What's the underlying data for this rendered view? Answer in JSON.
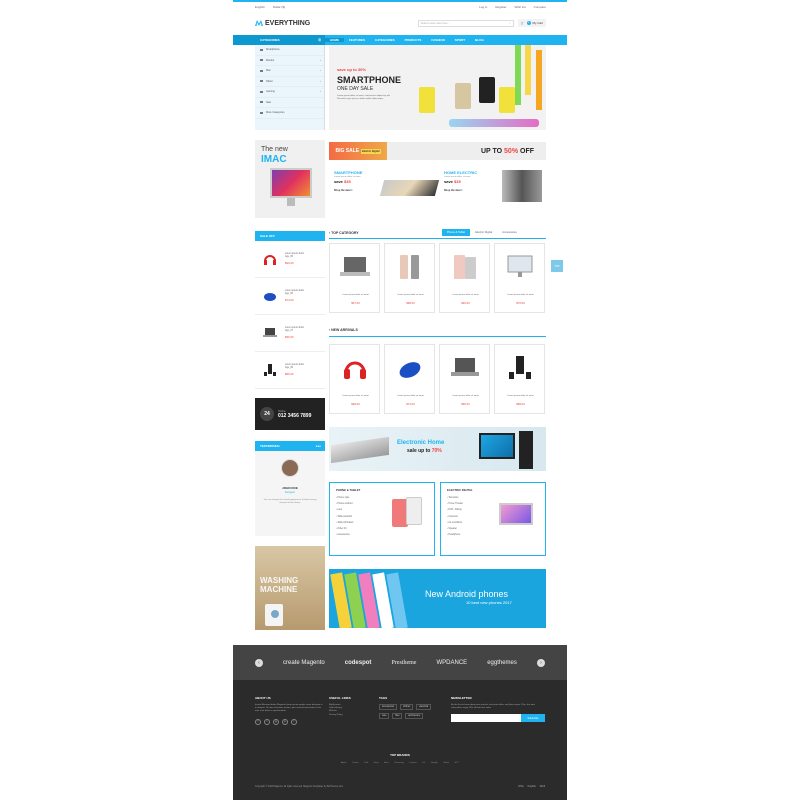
{
  "topbar": {
    "language": "English",
    "currency": "Dollar ($)",
    "links": [
      "Log in",
      "Register",
      "Wish list",
      "Compare"
    ]
  },
  "header": {
    "logo": "EVERYTHING",
    "search_placeholder": "Search entire store here...",
    "cart_count": "0",
    "cart_label": "My Cart"
  },
  "nav": {
    "categories_label": "CATEGORIES",
    "items": [
      "HOME",
      "FEATURES",
      "CATEGORIES",
      "PRODUCTS",
      "FASHION",
      "SPORT",
      "BLOG"
    ]
  },
  "sidebar_categories": [
    "Smartphone",
    "Monitor",
    "Mac",
    "Tablet",
    "Gaming",
    "Sale",
    "More Categories"
  ],
  "hero": {
    "subtitle": "save up to 30%",
    "title": "SMARTPHONE",
    "title2": "ONE DAY SALE",
    "description": "Lorem ipsum dolor sit amet, consectetur adipiscing elit. Phasellus quis ipsum a dolor mollis ullamcorper."
  },
  "imac_banner": {
    "line1": "The new",
    "line2": "IMAC"
  },
  "big_sale": {
    "label": "BIG SALE",
    "tag": "Electric Digital",
    "offer_prefix": "UP TO",
    "offer_value": "50%",
    "offer_suffix": "OFF"
  },
  "promos": [
    {
      "title": "SMARTPHONE",
      "desc": "Lorem ipsum dolor sit amet",
      "save_prefix": "save",
      "save_value": "$35",
      "cta": "Shop the deal >"
    },
    {
      "title": "HOME ELECTRIC",
      "desc": "Lorem ipsum dolor sit amet",
      "save_prefix": "save",
      "save_value": "$35",
      "cta": "Shop the deal >"
    }
  ],
  "sale_off": {
    "title": "SALE OFF",
    "items": [
      {
        "name": "Lorem ipsum dolor",
        "sub": "Agu_05",
        "price": "$99.00"
      },
      {
        "name": "Lorem ipsum dolor",
        "sub": "Agu_05",
        "price": "$74.00"
      },
      {
        "name": "Lorem ipsum dolor",
        "sub": "Agu_07",
        "price": "$56.00"
      },
      {
        "name": "Lorem ipsum dolor",
        "sub": "Agu_09",
        "price": "$89.00"
      }
    ]
  },
  "contact": {
    "phone": "012 3456 7899",
    "label": "Hotline"
  },
  "testimonial": {
    "title": "TESTIMONIAL",
    "name": "JOHN DOE",
    "role": "Designer",
    "quote": "You can change the visual appearance of almost every element of this theme"
  },
  "washer": {
    "line1": "WASHING",
    "line2": "MACHINE"
  },
  "top_category": {
    "title": "TOP CATEGORY",
    "tabs": [
      "Phone & Tablet",
      "Electric Digital",
      "Accessories"
    ],
    "products": [
      {
        "name": "Lorem ipsum dolor sit amet",
        "price": "$57.00"
      },
      {
        "name": "Lorem ipsum dolor sit amet",
        "price": "$98.00"
      },
      {
        "name": "Lorem ipsum dolor sit amet",
        "price": "$46.00"
      },
      {
        "name": "Lorem ipsum dolor sit amet",
        "price": "$76.00"
      }
    ]
  },
  "new_arrivals": {
    "title": "NEW ARRIVALS",
    "products": [
      {
        "name": "Lorem ipsum dolor sit amet",
        "price": "$99.00"
      },
      {
        "name": "Lorem ipsum dolor sit amet",
        "price": "$74.00"
      },
      {
        "name": "Lorem ipsum dolor sit amet",
        "price": "$56.00"
      },
      {
        "name": "Lorem ipsum dolor sit amet",
        "price": "$89.00"
      }
    ]
  },
  "top_badge": "TOP",
  "electronic_banner": {
    "line1": "Electronic Home",
    "line2_prefix": "sale up to",
    "line2_value": "70%"
  },
  "phone_tablet": {
    "title": "PHONE & TABLET",
    "items": [
      "Phone style",
      "Phone android",
      "Aero",
      "Tablet android",
      "Tablet Windows",
      "Other Kit",
      "Accessories"
    ]
  },
  "electric_digital": {
    "title": "ELECTRIC DIGITAL",
    "items": [
      "Television",
      "Home Theater",
      "DVD - Bluray",
      "Cameras",
      "Air-conditions",
      "Speaker",
      "Headphone"
    ]
  },
  "android_banner": {
    "line1": "New Android phones",
    "line2": "10 best new phones 2017"
  },
  "brands": [
    "create Magento",
    "codespot",
    "Prestheme",
    "WPDANCE",
    "eggthemes"
  ],
  "footer": {
    "about_title": "ABOUT US",
    "about_text": "Ipsum Massum dolore Magenta lorem ipsum people come lemisum ut mi tempor. Ut enim ad minim veniam, quis nostrud exercitation. Duis aute irure dolor in reprehenderit.",
    "useful_title": "USEFUL LINKS",
    "useful_links": [
      "My Account",
      "Order History",
      "Wishlist",
      "Privacy Policy"
    ],
    "tags_title": "TAGS",
    "tags": [
      "accessories",
      "clothes",
      "electrical",
      "care",
      "files",
      "architecture"
    ],
    "newsletter_title": "NEWSLETTER",
    "newsletter_text": "Be the first to know about new arrivals, exclusive offers and latest news. Plus, first time subscribers enjoy 15% off their first order.",
    "subscribe": "Subscribe",
    "top_brands_title": "TOP BRANDS",
    "top_brands": [
      "Apple",
      "Canon",
      "Dell",
      "Sony",
      "Asus",
      "Samsung",
      "Lenovo",
      "LG",
      "Google",
      "Nokia",
      "HTC"
    ],
    "copyright": "Copyright © 2018 Magento. All rights reserved. Magento Templates by BeThemes.com",
    "payments": [
      "VISA",
      "PayPal",
      "Skrill"
    ]
  }
}
